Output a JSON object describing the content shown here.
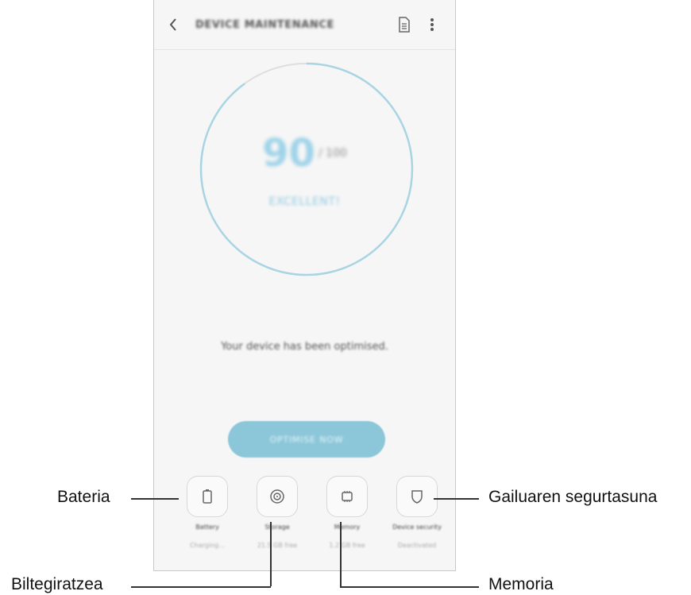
{
  "app": {
    "title": "DEVICE MAINTENANCE",
    "back_icon": "back-arrow-icon",
    "report_icon": "document-icon",
    "menu_icon": "more-vert-icon"
  },
  "score": {
    "value": "90",
    "max": "/ 100",
    "status": "EXCELLENT!",
    "progress": 0.9,
    "ring_color": "#a9d4e3",
    "accent_color": "#8cc7d9"
  },
  "message": "Your device has been optimised.",
  "optimise_button": "OPTIMISE NOW",
  "tiles": [
    {
      "label": "Battery",
      "status": "Charging...",
      "icon": "battery-icon"
    },
    {
      "label": "Storage",
      "status": "21.5 GB free",
      "icon": "storage-icon"
    },
    {
      "label": "Memory",
      "status": "1.2 GB free",
      "icon": "memory-chip-icon"
    },
    {
      "label": "Device security",
      "status": "Deactivated",
      "icon": "shield-icon"
    }
  ],
  "callouts": {
    "battery": "Bateria",
    "storage": "Biltegiratzea",
    "memory": "Memoria",
    "security": "Gailuaren segurtasuna"
  }
}
